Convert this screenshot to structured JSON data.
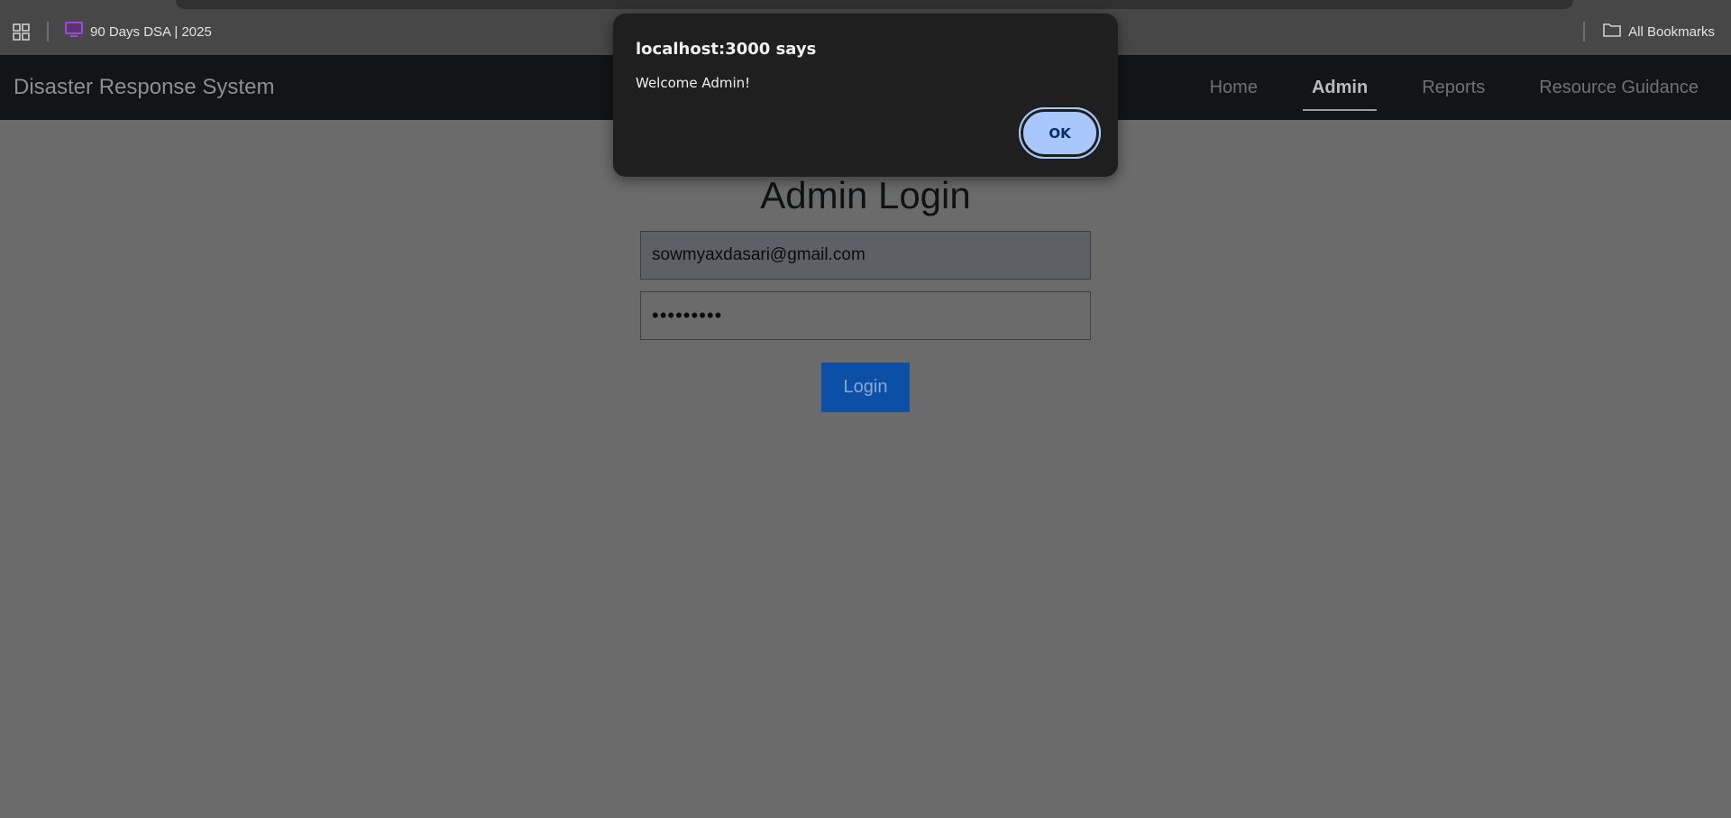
{
  "browser": {
    "bookmarks": [
      {
        "label": "90 Days DSA | 2025",
        "icon": "screen-icon",
        "icon_color": "#a142f4"
      }
    ],
    "all_bookmarks_label": "All Bookmarks"
  },
  "navbar": {
    "brand": "Disaster Response System",
    "links": [
      {
        "label": "Home",
        "active": false
      },
      {
        "label": "Admin",
        "active": true
      },
      {
        "label": "Reports",
        "active": false
      },
      {
        "label": "Resource Guidance",
        "active": false
      }
    ]
  },
  "login": {
    "title": "Admin Login",
    "email_value": "sowmyaxdasari@gmail.com",
    "password_value": "•••••••••",
    "button_label": "Login"
  },
  "dialog": {
    "title": "localhost:3000 says",
    "message": "Welcome Admin!",
    "ok_label": "OK"
  },
  "colors": {
    "navbar_bg": "#121416",
    "page_overlay_bg": "#6b6b6b",
    "login_button_bg": "#0b4fa6",
    "dialog_bg": "#1f1f1f",
    "ok_button_bg": "#a8c7fa"
  }
}
